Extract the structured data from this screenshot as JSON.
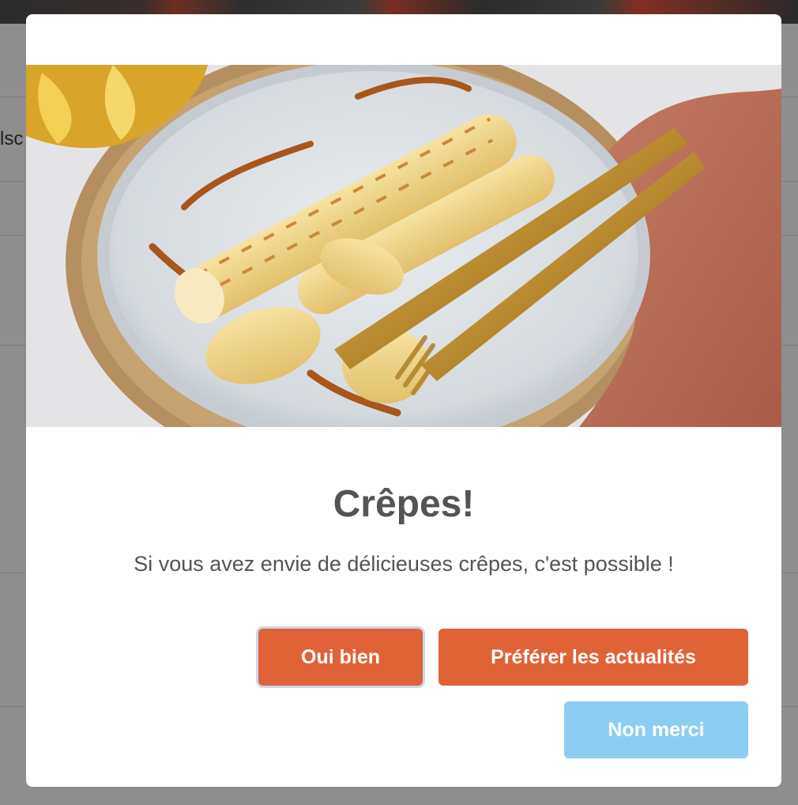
{
  "modal": {
    "title": "Crêpes!",
    "text": "Si vous avez envie de délicieuses crêpes, c'est possible !",
    "buttons": {
      "confirm": "Oui bien",
      "deny": "Préférer les actualités",
      "cancel": "Non merci"
    }
  },
  "background": {
    "partial_text": "lsc"
  },
  "colors": {
    "accent": "#e06237",
    "cancel": "#8ccdf4",
    "title_text": "#545454",
    "overlay": "#8f8f8f"
  }
}
